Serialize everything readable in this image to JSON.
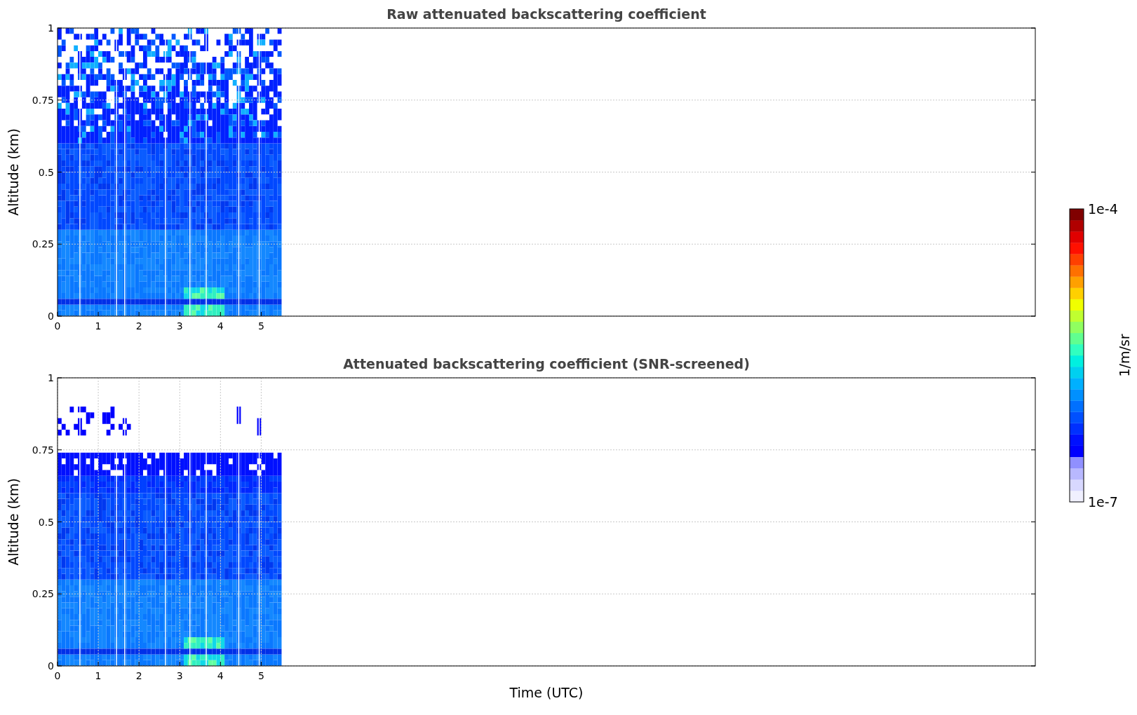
{
  "panels": [
    {
      "kind": "raw",
      "title": "Raw attenuated backscattering coefficient",
      "ylabel": "Altitude (km)",
      "yticks": [
        "1",
        "0.75",
        "0.5",
        "0.25",
        "0"
      ],
      "xticks": [
        "0",
        "1",
        "2",
        "3",
        "4",
        "5"
      ]
    },
    {
      "kind": "screened",
      "title": "Attenuated backscattering coefficient (SNR-screened)",
      "ylabel": "Altitude (km)",
      "yticks": [
        "1",
        "0.75",
        "0.5",
        "0.25",
        "0"
      ],
      "xticks": [
        "0",
        "1",
        "2",
        "3",
        "4",
        "5"
      ]
    }
  ],
  "xlabel": "Time (UTC)",
  "colorbar": {
    "max": "1e-4",
    "min": "1e-7",
    "label": "1/m/sr"
  }
}
